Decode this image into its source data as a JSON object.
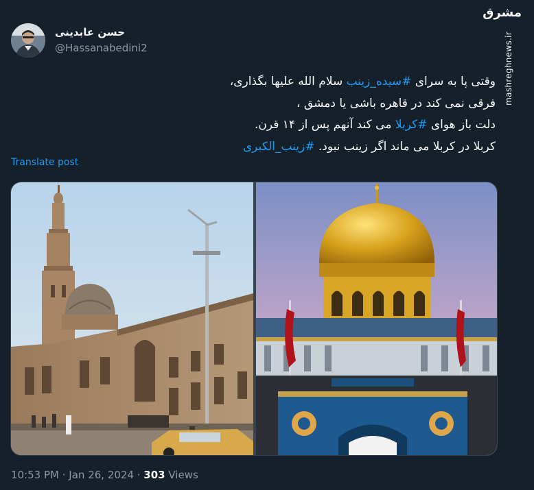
{
  "author": {
    "display_name": "حسن عابدینی",
    "handle": "@Hassanabedini2"
  },
  "watermark": {
    "logo": "مشرق",
    "url": "mashreghnews.ir"
  },
  "tweet": {
    "line1": {
      "before": "وقتی پا به سرای ",
      "hashtag": "#سیده_زینب",
      "after": " سلام الله علیها بگذاری،"
    },
    "line2": "فرقی نمی کند در قاهره باشی یا دمشق ،",
    "line3": {
      "before": "دلت باز هوای ",
      "hashtag": "#کربلا",
      "after": " می کند آنهم پس از ۱۴ قرن."
    },
    "line4": {
      "before": "کربلا در کربلا می ماند اگر زینب نبود. ",
      "hashtag": "#زینب_الکبری"
    }
  },
  "translate_label": "Translate post",
  "media": {
    "left_alt": "Sayyida Zeinab mosque in Cairo with minaret and dome",
    "right_alt": "Golden dome of the Sayyida Zeinab shrine in Damascus"
  },
  "meta": {
    "time": "10:53 PM",
    "separator": " · ",
    "date": "Jan 26, 2024",
    "views_count": "303",
    "views_label": " Views"
  },
  "colors": {
    "background": "#15202b",
    "text": "#f7f9f9",
    "secondary": "#8b98a5",
    "accent": "#1d9bf0"
  }
}
